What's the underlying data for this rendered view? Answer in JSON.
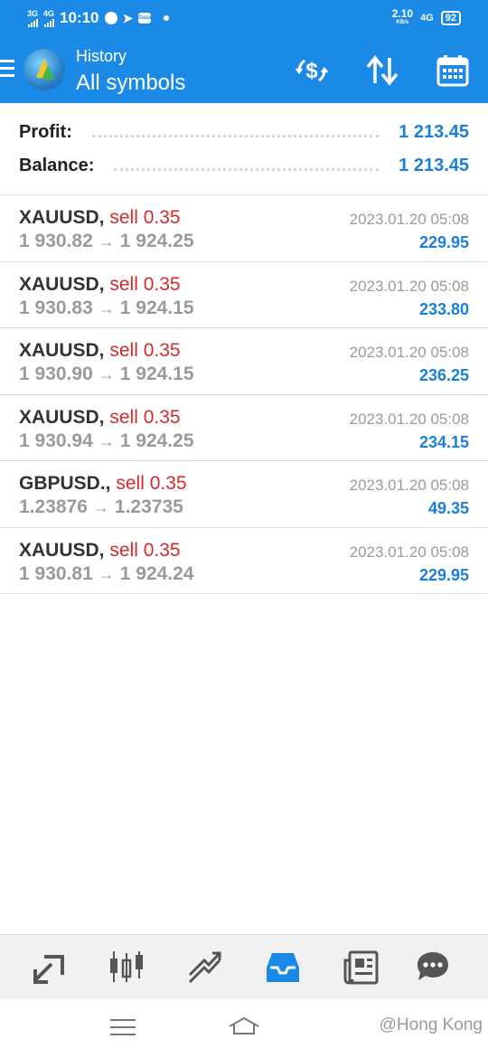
{
  "status_bar": {
    "network1": "3G",
    "network2": "4G",
    "time": "10:10",
    "app_badge": "Gaza",
    "speed": "2.10",
    "speed_unit": "KB/s",
    "network3": "4G",
    "battery": "92"
  },
  "app_bar": {
    "subtitle": "History",
    "title": "All symbols",
    "icons": [
      "menu-icon",
      "currency-exchange-icon",
      "sort-icon",
      "calendar-icon"
    ]
  },
  "summary": {
    "profit_label": "Profit:",
    "profit_value": "1 213.45",
    "balance_label": "Balance:",
    "balance_value": "1 213.45"
  },
  "trades": [
    {
      "symbol": "XAUUSD,",
      "side": "sell 0.35",
      "open": "1 930.82",
      "close": "1 924.25",
      "arrow": "→",
      "time": "2023.01.20 05:08",
      "profit": "229.95"
    },
    {
      "symbol": "XAUUSD,",
      "side": "sell 0.35",
      "open": "1 930.83",
      "close": "1 924.15",
      "arrow": "→",
      "time": "2023.01.20 05:08",
      "profit": "233.80"
    },
    {
      "symbol": "XAUUSD,",
      "side": "sell 0.35",
      "open": "1 930.90",
      "close": "1 924.15",
      "arrow": "→",
      "time": "2023.01.20 05:08",
      "profit": "236.25"
    },
    {
      "symbol": "XAUUSD,",
      "side": "sell 0.35",
      "open": "1 930.94",
      "close": "1 924.25",
      "arrow": "→",
      "time": "2023.01.20 05:08",
      "profit": "234.15"
    },
    {
      "symbol": "GBPUSD.,",
      "side": "sell 0.35",
      "open": "1.23876",
      "close": "1.23735",
      "arrow": "→",
      "time": "2023.01.20 05:08",
      "profit": "49.35"
    },
    {
      "symbol": "XAUUSD,",
      "side": "sell 0.35",
      "open": "1 930.81",
      "close": "1 924.24",
      "arrow": "→",
      "time": "2023.01.20 05:08",
      "profit": "229.95"
    }
  ],
  "bottom_nav": {
    "items": [
      "quotes-icon",
      "chart-icon",
      "trade-icon",
      "history-icon",
      "news-icon",
      "messages-icon"
    ],
    "active": "history-icon",
    "active_color": "#1a8ae6",
    "inactive_color": "#555555"
  },
  "watermark": "@Hong Kong",
  "colors": {
    "accent": "#1a8ae6",
    "sell": "#d42a2a",
    "profit": "#1a7fd8"
  }
}
